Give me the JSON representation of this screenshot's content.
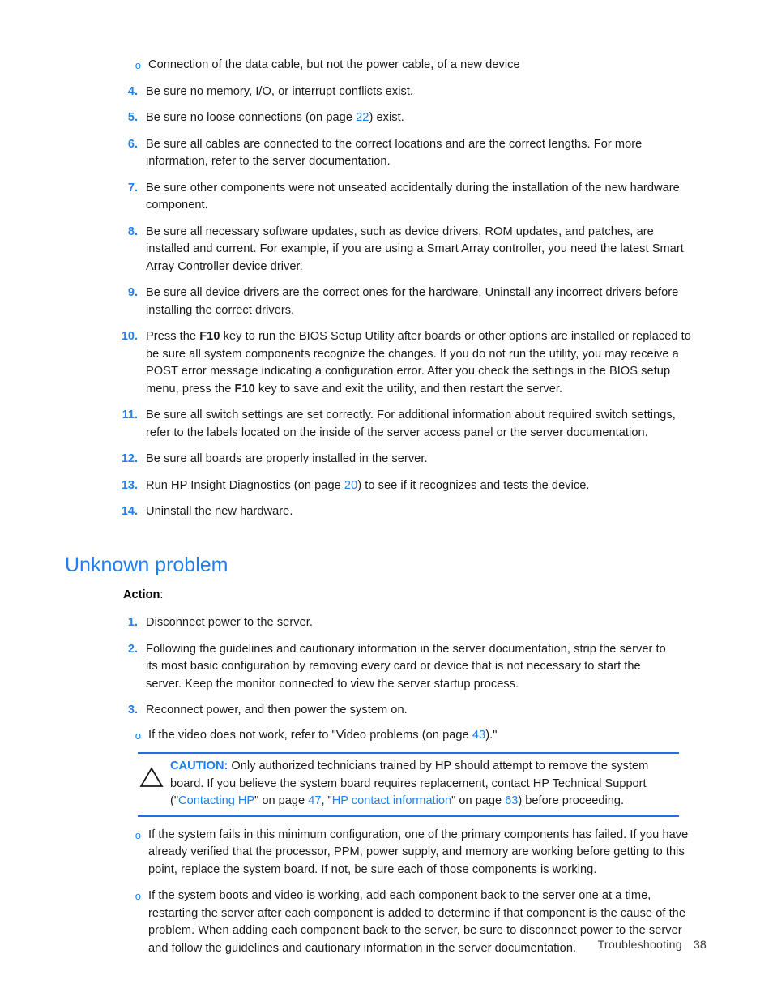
{
  "document": {
    "section_heading": "Unknown problem",
    "action_label": "Action",
    "action_colon": ":"
  },
  "list_continued": {
    "sub_bullet_marker": "o",
    "sub_bullet_text": "Connection of the data cable, but not the power cable, of a new device",
    "items": [
      {
        "number": "4.",
        "text": "Be sure no memory, I/O, or interrupt conflicts exist."
      },
      {
        "number": "5.",
        "text_before": "Be sure no loose connections (on page ",
        "link": "22",
        "text_after": ") exist."
      },
      {
        "number": "6.",
        "text": "Be sure all cables are connected to the correct locations and are the correct lengths. For more information, refer to the server documentation."
      },
      {
        "number": "7.",
        "text": "Be sure other components were not unseated accidentally during the installation of the new hardware component."
      },
      {
        "number": "8.",
        "text": "Be sure all necessary software updates, such as device drivers, ROM updates, and patches, are installed and current. For example, if you are using a Smart Array controller, you need the latest Smart Array Controller device driver."
      },
      {
        "number": "9.",
        "text": "Be sure all device drivers are the correct ones for the hardware. Uninstall any incorrect drivers before installing the correct drivers."
      },
      {
        "number": "10.",
        "part1": "Press the ",
        "key1": "F10",
        "part2": " key to run the BIOS Setup Utility after boards or other options are installed or replaced to be sure all system components recognize the changes. If you do not run the utility, you may receive a POST error message indicating a configuration error. After you check the settings in the BIOS setup menu, press the ",
        "key2": "F10",
        "part3": " key to save and exit the utility, and then restart the server."
      },
      {
        "number": "11.",
        "text": "Be sure all switch settings are set correctly. For additional information about required switch settings, refer to the labels located on the inside of the server access panel or the server documentation."
      },
      {
        "number": "12.",
        "text": "Be sure all boards are properly installed in the server."
      },
      {
        "number": "13.",
        "text_before": "Run HP Insight Diagnostics (on page ",
        "link": "20",
        "text_after": ") to see if it recognizes and tests the device."
      },
      {
        "number": "14.",
        "text": "Uninstall the new hardware."
      }
    ]
  },
  "unknown_problem": {
    "items": [
      {
        "number": "1.",
        "text": "Disconnect power to the server."
      },
      {
        "number": "2.",
        "text": "Following the guidelines and cautionary information in the server documentation, strip the server to its most basic configuration by removing every card or device that is not necessary to start the server. Keep the monitor connected to view the server startup process."
      },
      {
        "number": "3.",
        "text": "Reconnect power, and then power the system on."
      }
    ],
    "sub_bullets": [
      {
        "marker": "o",
        "text_before": "If the video does not work, refer to \"Video problems (on page ",
        "link": "43",
        "text_after": ").\""
      },
      {
        "marker": "o",
        "text": "If the system fails in this minimum configuration, one of the primary components has failed. If you have already verified that the processor, PPM, power supply, and memory are working before getting to this point, replace the system board. If not, be sure each of those components is working."
      },
      {
        "marker": "o",
        "text": "If the system boots and video is working, add each component back to the server one at a time, restarting the server after each component is added to determine if that component is the cause of the problem. When adding each component back to the server, be sure to disconnect power to the server and follow the guidelines and cautionary information in the server documentation."
      }
    ]
  },
  "caution": {
    "icon": "warning-triangle-icon",
    "label": "CAUTION:",
    "text_part1": " Only authorized technicians trained by HP should attempt to remove the system board. If you believe the system board requires replacement, contact HP Technical Support (\"",
    "link1": "Contacting HP",
    "text_part2": "\" on page ",
    "page1": "47",
    "text_part3": ", \"",
    "link2": "HP contact information",
    "text_part4": "\" on page ",
    "page2": "63",
    "text_part5": ") before proceeding."
  },
  "footer": {
    "chapter": "Troubleshooting",
    "page_number": "38"
  },
  "colors": {
    "heading_blue": "#1f7fef",
    "link_blue": "#1f7fef",
    "rule_blue": "#1f6fe0",
    "body_black": "#1a1a1a"
  }
}
